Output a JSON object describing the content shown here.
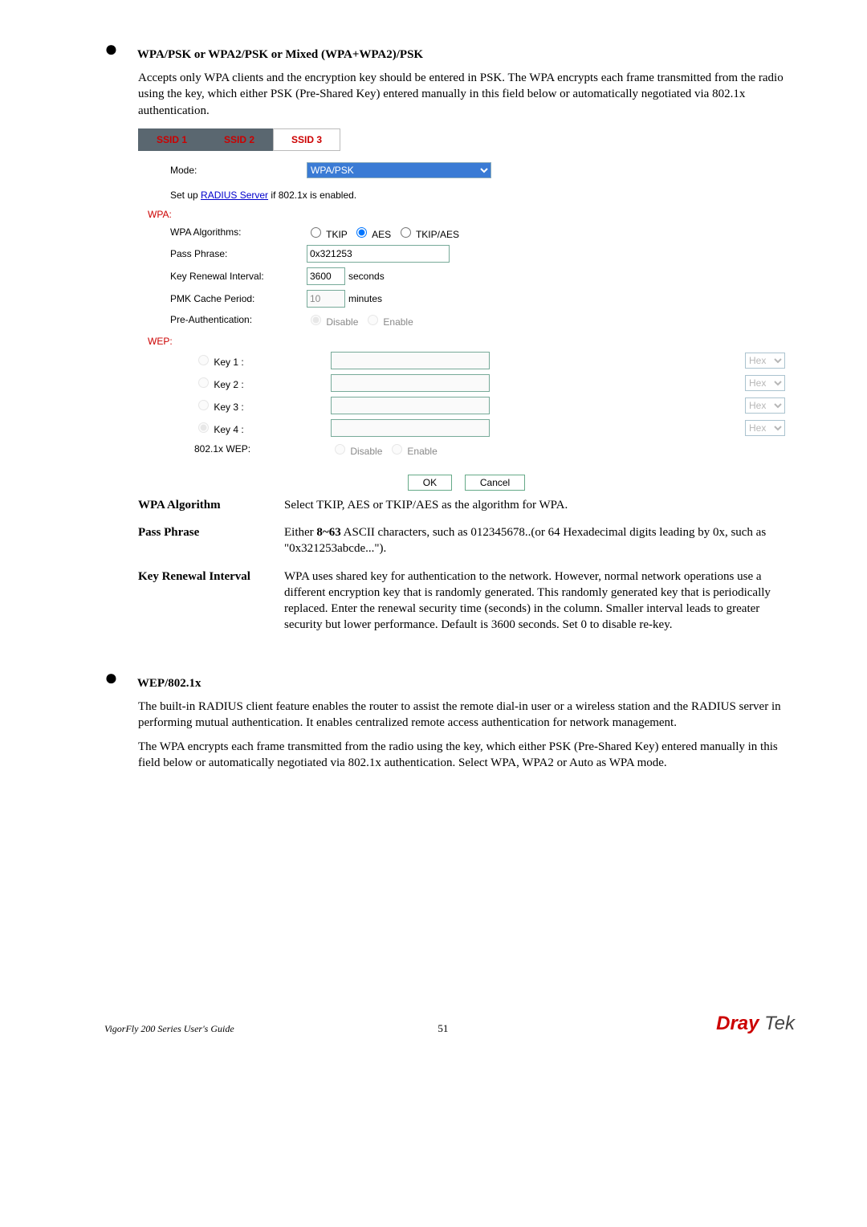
{
  "section1": {
    "title": "WPA/PSK or WPA2/PSK or Mixed (WPA+WPA2)/PSK",
    "para": "Accepts only WPA clients and the encryption key should be entered in PSK. The WPA encrypts each frame transmitted from the radio using the key, which either PSK (Pre-Shared Key) entered manually in this field below or automatically negotiated via 802.1x authentication."
  },
  "screenshot": {
    "tabs": [
      "SSID 1",
      "SSID 2",
      "SSID 3"
    ],
    "mode_label": "Mode:",
    "mode_value": "WPA/PSK",
    "radius_pre": "Set up ",
    "radius_link": "RADIUS Server",
    "radius_post": " if 802.1x is enabled.",
    "wpa_section": "WPA:",
    "wpa_algo_label": "WPA Algorithms:",
    "algo_opts": [
      "TKIP",
      "AES",
      "TKIP/AES"
    ],
    "pass_label": "Pass Phrase:",
    "pass_value": "0x321253",
    "key_renew_label": "Key Renewal Interval:",
    "key_renew_value": "3600",
    "key_renew_unit": "seconds",
    "pmk_label": "PMK Cache Period:",
    "pmk_value": "10",
    "pmk_unit": "minutes",
    "preauth_label": "Pre-Authentication:",
    "disable": "Disable",
    "enable": "Enable",
    "wep_section": "WEP:",
    "keys": [
      "Key 1 :",
      "Key 2 :",
      "Key 3 :",
      "Key 4 :"
    ],
    "hex": "Hex",
    "wep8021x_label": "802.1x WEP:",
    "ok": "OK",
    "cancel": "Cancel"
  },
  "defs": {
    "wpa_algo_term": "WPA Algorithm",
    "wpa_algo_def": "Select TKIP, AES or TKIP/AES as the algorithm for WPA.",
    "pass_term": "Pass Phrase",
    "pass_def": "Either 8~63 ASCII characters, such as 012345678..(or 64 Hexadecimal digits leading by 0x, such as \"0x321253abcde...\").",
    "pass_def_bold": "8~63",
    "key_renew_term": "Key Renewal Interval",
    "key_renew_def": "WPA uses shared key for authentication to the network. However, normal network operations use a different encryption key that is randomly generated. This randomly generated key that is periodically replaced. Enter the renewal security time (seconds) in the column. Smaller interval leads to greater security but lower performance. Default is 3600 seconds. Set 0 to disable re-key."
  },
  "section2": {
    "title": "WEP/802.1x",
    "para1": "The built-in RADIUS client feature enables the router to assist the remote dial-in user or a wireless station and the RADIUS server in performing mutual authentication. It enables centralized remote access authentication for network management.",
    "para2": "The WPA encrypts each frame transmitted from the radio using the key, which either PSK (Pre-Shared Key) entered manually in this field below or automatically negotiated via 802.1x authentication. Select WPA, WPA2 or Auto as WPA mode."
  },
  "footer": {
    "guide": "VigorFly 200 Series User's Guide",
    "page": "51",
    "brand1": "Dray",
    "brand2": " Tek"
  }
}
